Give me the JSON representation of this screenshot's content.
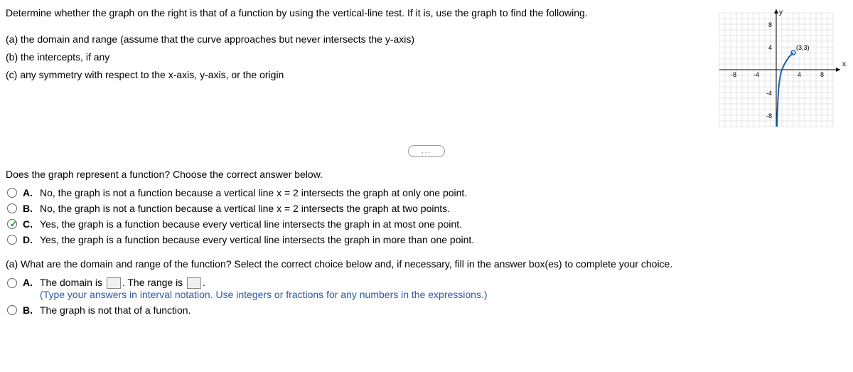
{
  "intro": {
    "line1": "Determine whether the graph on the right is that of a function by using the vertical-line test. If it is, use the graph to find the following.",
    "part_a": "(a) the domain and range (assume that the curve approaches but never intersects the y-axis)",
    "part_b": "(b) the intercepts, if any",
    "part_c": "(c) any symmetry with respect to the x-axis, y-axis, or the origin"
  },
  "graph": {
    "x_label": "x",
    "y_label": "y",
    "ticks": {
      "neg8": "-8",
      "neg4": "-4",
      "pos4": "4",
      "pos8": "8"
    },
    "point_label": "(3,3)",
    "x_range": [
      -10,
      10
    ],
    "y_range": [
      -10,
      10
    ]
  },
  "q1": {
    "prompt": "Does the graph represent a function? Choose the correct answer below.",
    "choices": {
      "A": "No, the graph is not a function because a vertical line x = 2 intersects the graph at only one point.",
      "B": "No, the graph is not a function because a vertical line x = 2 intersects the graph at two points.",
      "C": "Yes, the graph is a function because every vertical line intersects the graph in at most one point.",
      "D": "Yes, the graph is a function because every vertical line intersects the graph in more than one point."
    },
    "selected": "C",
    "letters": {
      "A": "A.",
      "B": "B.",
      "C": "C.",
      "D": "D."
    }
  },
  "q2": {
    "prompt": "(a) What are the domain and range of the function? Select the correct choice below and, if necessary, fill in the answer box(es) to complete your choice.",
    "choice_A_pre": "The domain is ",
    "choice_A_mid": ". The range is ",
    "choice_A_post": ".",
    "choice_A_instruction": "(Type your answers in interval notation. Use integers or fractions for any numbers in the expressions.)",
    "choice_B": "The graph is not that of a function.",
    "letters": {
      "A": "A.",
      "B": "B."
    }
  },
  "ellipsis": "..."
}
